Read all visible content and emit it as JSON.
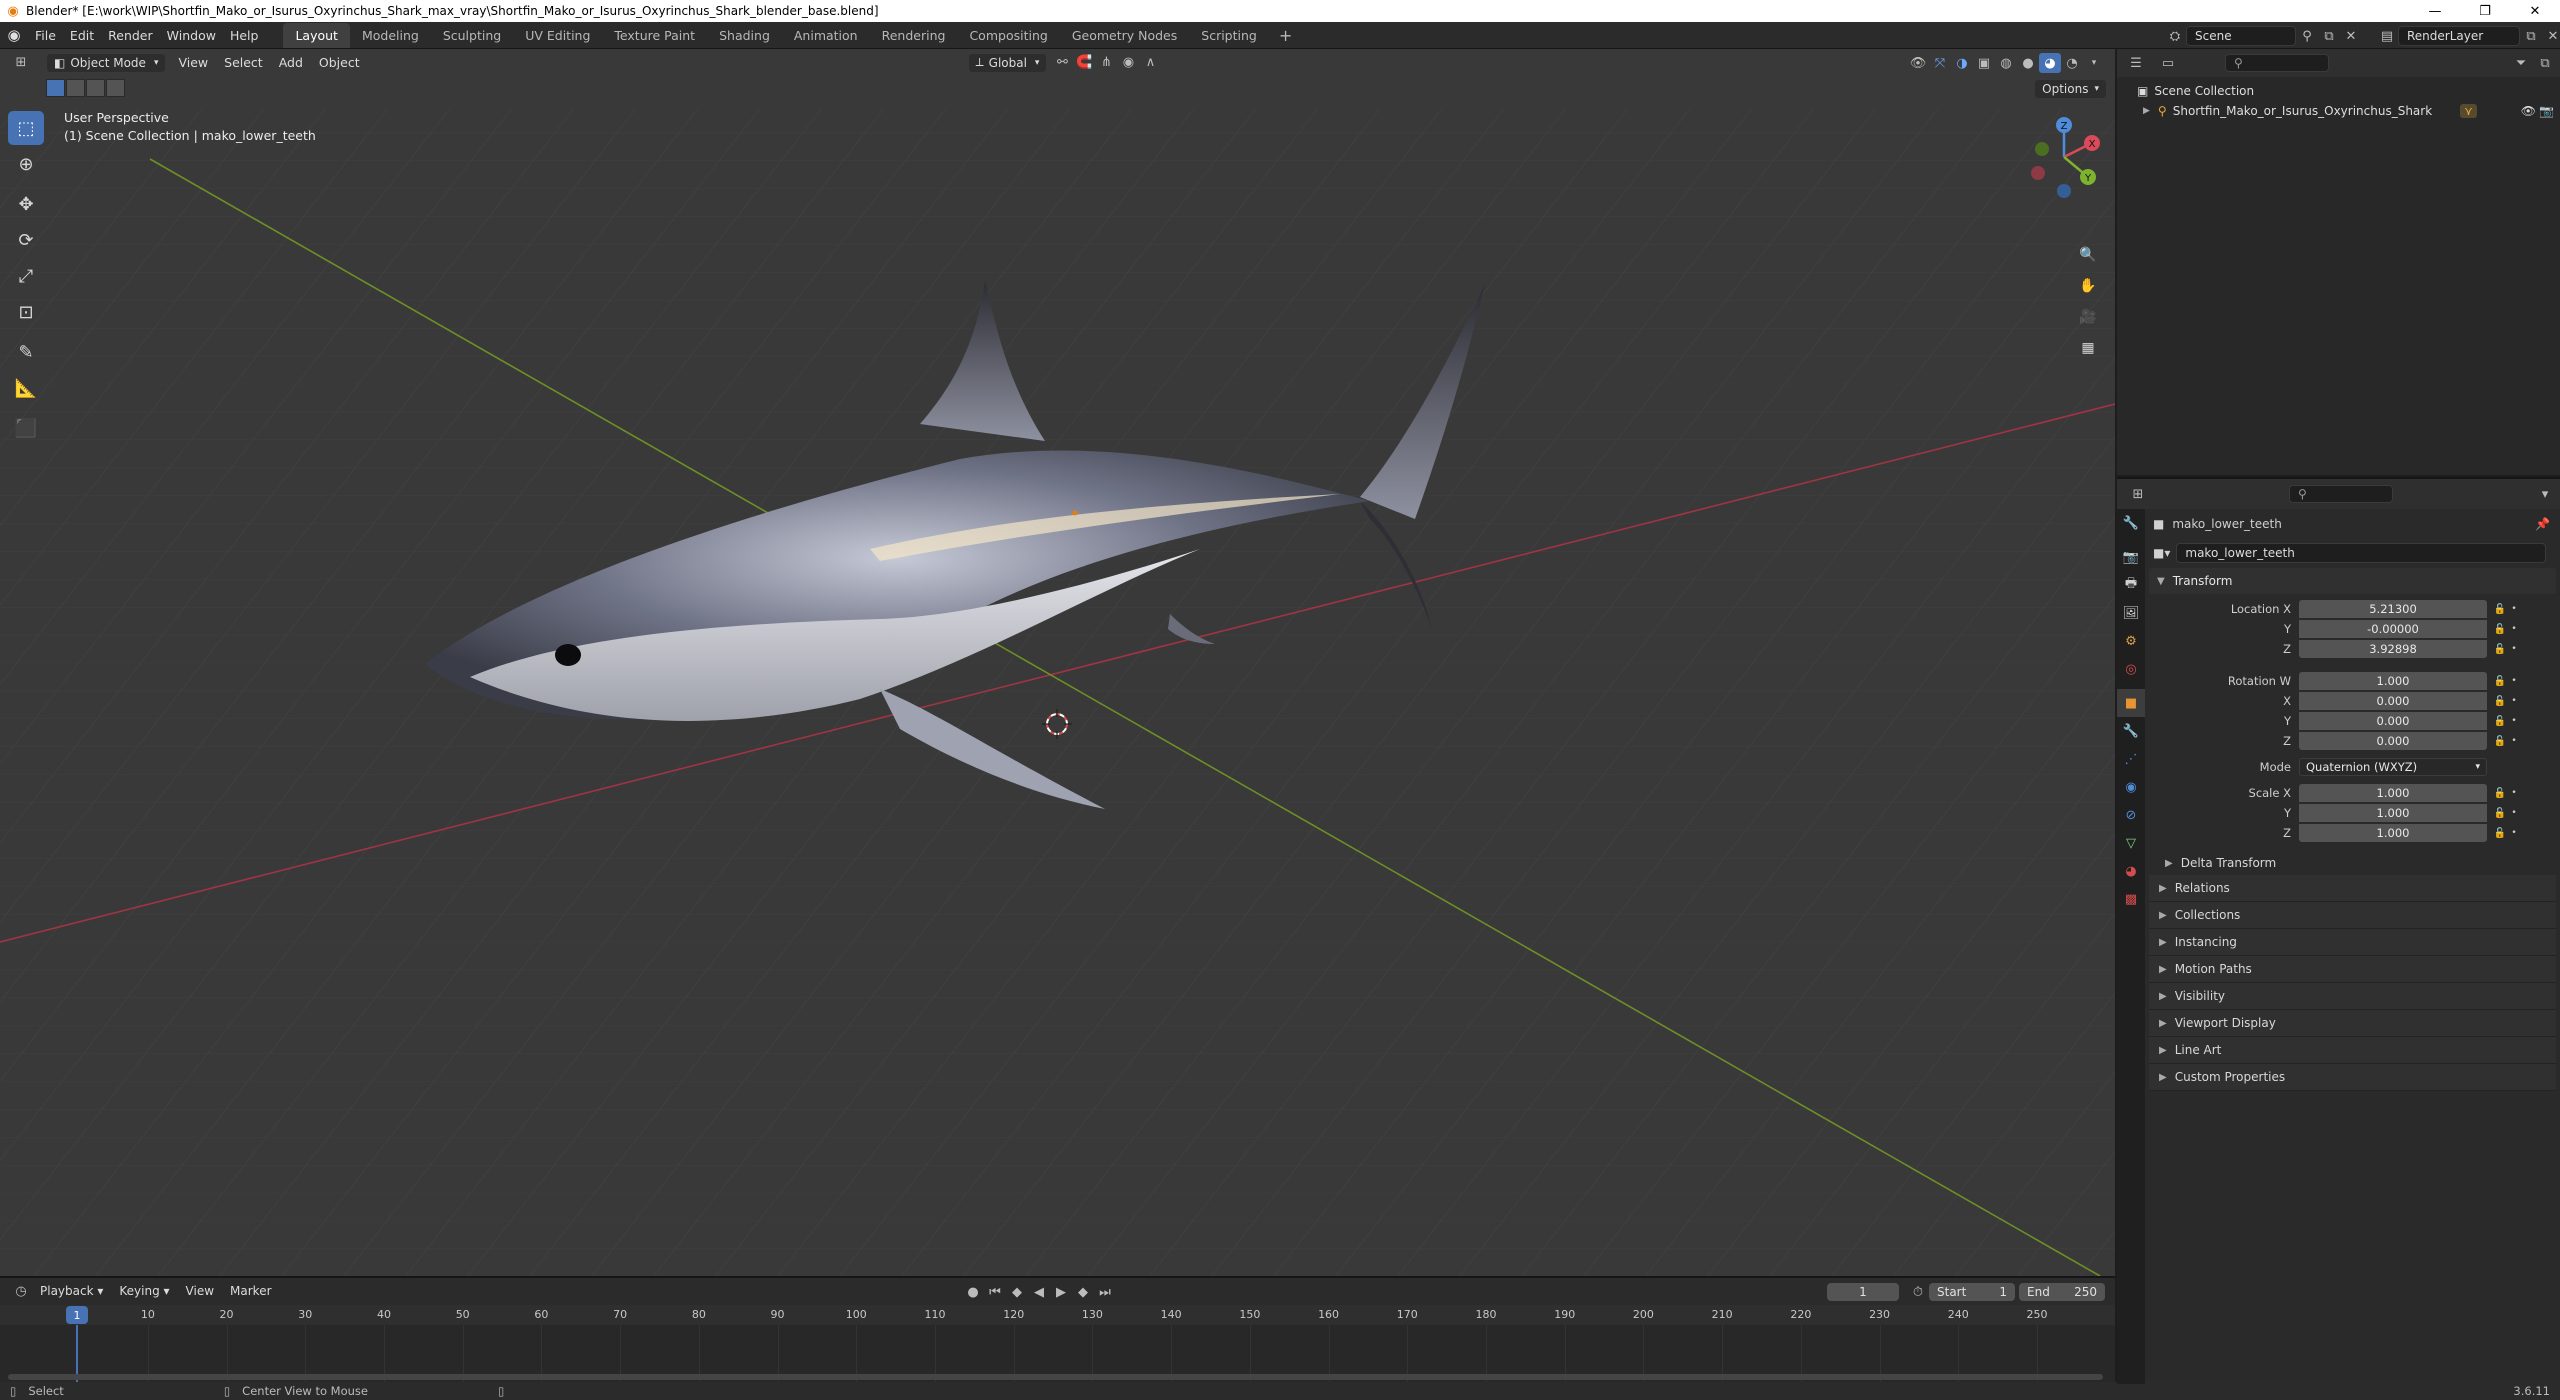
{
  "window": {
    "title": "Blender* [E:\\work\\WIP\\Shortfin_Mako_or_Isurus_Oxyrinchus_Shark_max_vray\\Shortfin_Mako_or_Isurus_Oxyrinchus_Shark_blender_base.blend]",
    "minimize": "—",
    "restore": "❐",
    "close": "✕"
  },
  "menu": [
    "File",
    "Edit",
    "Render",
    "Window",
    "Help"
  ],
  "workspaces": [
    "Layout",
    "Modeling",
    "Sculpting",
    "UV Editing",
    "Texture Paint",
    "Shading",
    "Animation",
    "Rendering",
    "Compositing",
    "Geometry Nodes",
    "Scripting"
  ],
  "active_workspace": "Layout",
  "scene": {
    "name": "Scene",
    "view_layer": "RenderLayer"
  },
  "viewport": {
    "mode": "Object Mode",
    "menus": [
      "View",
      "Select",
      "Add",
      "Object"
    ],
    "transform_orientation": "Global",
    "options_label": "Options",
    "info_line1": "User Perspective",
    "info_line2": "(1) Scene Collection | mako_lower_teeth",
    "gizmo": {
      "x": "X",
      "y": "Y",
      "z": "Z"
    }
  },
  "outliner": {
    "root": "Scene Collection",
    "items": [
      "Shortfin_Mako_or_Isurus_Oxyrinchus_Shark"
    ]
  },
  "properties": {
    "object_name": "mako_lower_teeth",
    "data_name": "mako_lower_teeth",
    "transform_title": "Transform",
    "location": {
      "label": "Location X",
      "x": "5.21300",
      "y": "-0.00000",
      "z": "3.92898"
    },
    "rotation": {
      "label": "Rotation W",
      "w": "1.000",
      "x": "0.000",
      "y": "0.000",
      "z": "0.000"
    },
    "mode_label": "Mode",
    "mode_value": "Quaternion (WXYZ)",
    "scale": {
      "label": "Scale X",
      "x": "1.000",
      "y": "1.000",
      "z": "1.000"
    },
    "axis_labels": {
      "x": "X",
      "y": "Y",
      "z": "Z"
    },
    "delta_transform": "Delta Transform",
    "panels": [
      "Relations",
      "Collections",
      "Instancing",
      "Motion Paths",
      "Visibility",
      "Viewport Display",
      "Line Art",
      "Custom Properties"
    ]
  },
  "timeline": {
    "menus": [
      "Playback",
      "Keying",
      "View",
      "Marker"
    ],
    "current_frame": "1",
    "start_label": "Start",
    "start": "1",
    "end_label": "End",
    "end": "250",
    "ruler_ticks": [
      "10",
      "20",
      "30",
      "40",
      "50",
      "60",
      "70",
      "80",
      "90",
      "100",
      "110",
      "120",
      "130",
      "140",
      "150",
      "160",
      "170",
      "180",
      "190",
      "200",
      "210",
      "220",
      "230",
      "240",
      "250"
    ],
    "playhead": "1"
  },
  "statusbar": {
    "select": "Select",
    "center": "Center View to Mouse",
    "version": "3.6.11"
  },
  "colors": {
    "accent": "#4772b3",
    "x_axis": "#c0394a",
    "y_axis": "#7da12a",
    "origin": "#e87d0d"
  }
}
